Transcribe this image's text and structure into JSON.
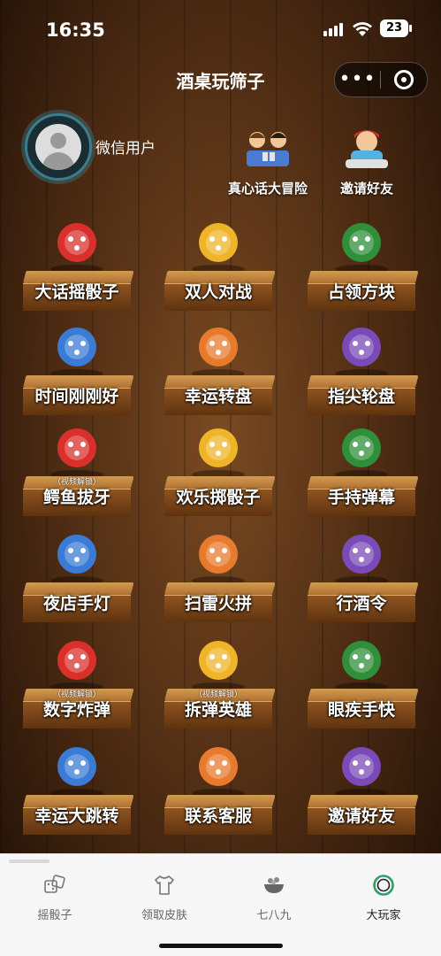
{
  "status": {
    "time": "16:35",
    "battery": "23"
  },
  "nav": {
    "title": "酒桌玩筛子",
    "more": "•••"
  },
  "profile": {
    "username": "微信用户"
  },
  "top_links": [
    {
      "label": "真心话大冒险",
      "icon": "truth-dare-icon"
    },
    {
      "label": "邀请好友",
      "icon": "invite-icon"
    }
  ],
  "unlock_text": "（视频解锁）",
  "games": [
    {
      "label": "大话摇骰子",
      "icon": "dice-cup-icon"
    },
    {
      "label": "双人对战",
      "icon": "fist-bump-icon"
    },
    {
      "label": "占领方块",
      "icon": "soldiers-icon"
    },
    {
      "label": "时间刚刚好",
      "icon": "alarm-clock-icon"
    },
    {
      "label": "幸运转盘",
      "icon": "lucky-wheel-icon"
    },
    {
      "label": "指尖轮盘",
      "icon": "fingertip-wheel-icon"
    },
    {
      "label": "鳄鱼拔牙",
      "icon": "crocodile-icon",
      "locked": true
    },
    {
      "label": "欢乐掷骰子",
      "icon": "dice-throw-icon"
    },
    {
      "label": "手持弹幕",
      "icon": "phone-barrage-icon"
    },
    {
      "label": "夜店手灯",
      "icon": "club-light-icon"
    },
    {
      "label": "扫雷火拼",
      "icon": "bomb-icon"
    },
    {
      "label": "行酒令",
      "icon": "drinking-game-icon"
    },
    {
      "label": "数字炸弹",
      "icon": "number-bomb-icon",
      "locked": true
    },
    {
      "label": "拆弹英雄",
      "icon": "dynamite-icon",
      "locked": true
    },
    {
      "label": "眼疾手快",
      "icon": "eyes-icon"
    },
    {
      "label": "幸运大跳转",
      "icon": "dancers-icon"
    },
    {
      "label": "联系客服",
      "icon": "customer-service-icon"
    },
    {
      "label": "邀请好友",
      "icon": "invite-dancers-icon"
    }
  ],
  "tabs": [
    {
      "label": "摇骰子",
      "icon": "dice-tab-icon",
      "active": false
    },
    {
      "label": "领取皮肤",
      "icon": "shirt-tab-icon",
      "active": false
    },
    {
      "label": "七八九",
      "icon": "bowl-tab-icon",
      "active": false
    },
    {
      "label": "大玩家",
      "icon": "player-tab-icon",
      "active": true
    }
  ],
  "colors": {
    "wood_dark": "#4b2a12",
    "board_top": "#d39a52",
    "tab_active": "#222222",
    "tab_inactive": "#666666"
  }
}
